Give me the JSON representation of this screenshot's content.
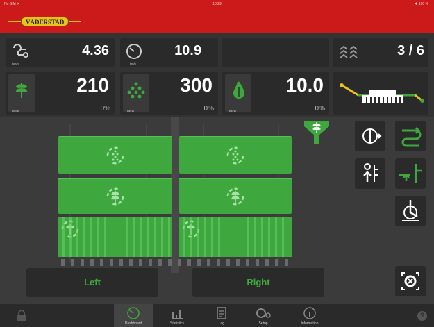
{
  "status_bar": {
    "left": "No SIM ✈",
    "center": "10:29",
    "right": "✱ 100 %"
  },
  "brand": {
    "logo_text": "VÄDERSTAD"
  },
  "top_row": {
    "speed_working": {
      "value": "4.36",
      "unit": "km/h",
      "icon": "working-speed-icon"
    },
    "speed": {
      "value": "10.9",
      "unit": "km/h",
      "icon": "speedometer-icon"
    },
    "tramline": {
      "value": "3 / 6",
      "icon": "tramline-icon"
    }
  },
  "second_row": {
    "seed": {
      "value": "210",
      "pct": "0%",
      "unit": "kg/ha",
      "icon": "seed-icon"
    },
    "fertilizer": {
      "value": "300",
      "pct": "0%",
      "unit": "kg/ha",
      "icon": "fertilizer-icon"
    },
    "liquid": {
      "value": "10.0",
      "pct": "0%",
      "unit": "kg/ha",
      "icon": "liquid-fertilizer-icon"
    },
    "machine": {
      "icon": "seed-drill-icon"
    }
  },
  "field": {
    "hopper_icon": "hopper-icon",
    "left_button": "Left",
    "right_button": "Right"
  },
  "controls": [
    {
      "name": "half-width-icon",
      "active": false
    },
    {
      "name": "section-control-icon",
      "active": true
    },
    {
      "name": "pre-emergence-marker-icon",
      "active": false
    },
    {
      "name": "marker-raise-icon",
      "active": true
    },
    {
      "name": "disc-pressure-icon",
      "active": false
    },
    {
      "name": "calibration-icon",
      "active": false
    }
  ],
  "tabs": [
    {
      "label": "Dashboard",
      "icon": "dashboard-icon",
      "active": true
    },
    {
      "label": "Statistics",
      "icon": "statistics-icon",
      "active": false
    },
    {
      "label": "Log",
      "icon": "log-icon",
      "active": false
    },
    {
      "label": "Setup",
      "icon": "setup-icon",
      "active": false
    },
    {
      "label": "Information",
      "icon": "information-icon",
      "active": false
    }
  ],
  "colors": {
    "brand_red": "#cc1a1a",
    "accent_green": "#3ea83e",
    "logo_yellow": "#e8c31a"
  }
}
